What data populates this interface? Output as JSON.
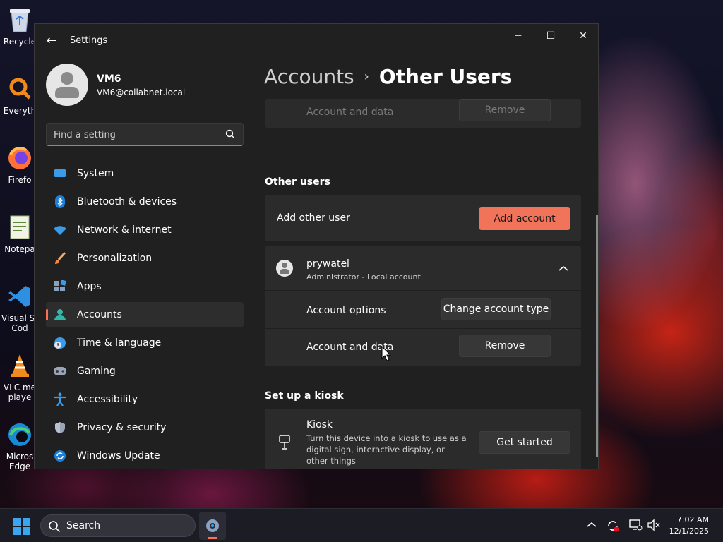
{
  "window": {
    "title": "Settings",
    "controls": {
      "minimize": "─",
      "maximize": "☐",
      "close": "✕",
      "back": "←"
    }
  },
  "profile": {
    "name": "VM6",
    "email": "VM6@collabnet.local"
  },
  "search": {
    "placeholder": "Find a setting"
  },
  "nav": [
    {
      "label": "System",
      "icon": "system-icon"
    },
    {
      "label": "Bluetooth & devices",
      "icon": "bluetooth-icon"
    },
    {
      "label": "Network & internet",
      "icon": "wifi-icon"
    },
    {
      "label": "Personalization",
      "icon": "brush-icon"
    },
    {
      "label": "Apps",
      "icon": "apps-icon"
    },
    {
      "label": "Accounts",
      "icon": "accounts-icon",
      "active": true
    },
    {
      "label": "Time & language",
      "icon": "globe-clock-icon"
    },
    {
      "label": "Gaming",
      "icon": "gamepad-icon"
    },
    {
      "label": "Accessibility",
      "icon": "accessibility-icon"
    },
    {
      "label": "Privacy & security",
      "icon": "shield-icon"
    },
    {
      "label": "Windows Update",
      "icon": "update-icon"
    }
  ],
  "breadcrumb": {
    "parent": "Accounts",
    "separator": "›",
    "current": "Other Users"
  },
  "top_partial": {
    "label": "Account and data",
    "button": "Remove"
  },
  "other_users": {
    "title": "Other users",
    "add_label": "Add other user",
    "add_button": "Add account",
    "user": {
      "name": "prywatel",
      "subtitle": "Administrator - Local account",
      "options_label": "Account options",
      "options_button": "Change account type",
      "data_label": "Account and data",
      "data_button": "Remove"
    }
  },
  "kiosk": {
    "title": "Set up a kiosk",
    "card_title": "Kiosk",
    "description": "Turn this device into a kiosk to use as a digital sign, interactive display, or other things",
    "button": "Get started"
  },
  "desktop_icons": [
    {
      "label": "Recycle",
      "icon": "recycle-bin-icon"
    },
    {
      "label": "Everyth",
      "icon": "everything-icon"
    },
    {
      "label": "Firefo",
      "icon": "firefox-icon"
    },
    {
      "label": "Notepa",
      "icon": "notepad-icon"
    },
    {
      "label": "Visual St",
      "label2": "Cod",
      "icon": "vscode-icon"
    },
    {
      "label": "VLC me",
      "label2": "playe",
      "icon": "vlc-icon"
    },
    {
      "label": "Micros",
      "label2": "Edge",
      "icon": "edge-icon"
    }
  ],
  "taskbar": {
    "search_label": "Search",
    "time": "7:02 AM",
    "date": "12/1/2025"
  },
  "colors": {
    "accent": "#f0735a",
    "window_bg": "#202020",
    "card_bg": "#2b2b2b"
  }
}
